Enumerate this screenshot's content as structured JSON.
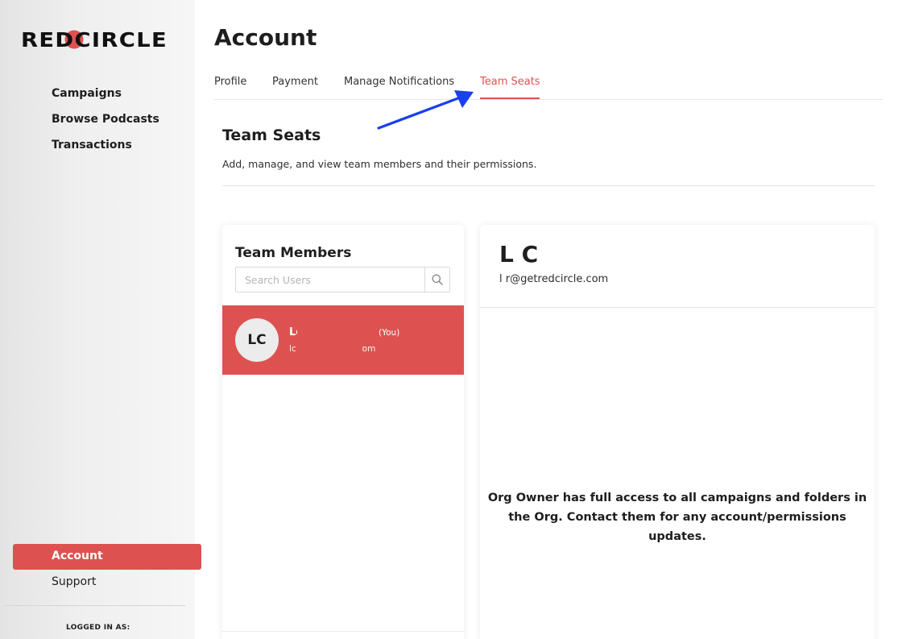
{
  "brand": {
    "logo_text": "REDCIRCLE",
    "accent_color": "#dd5250"
  },
  "sidebar": {
    "nav": [
      {
        "label": "Campaigns"
      },
      {
        "label": "Browse Podcasts"
      },
      {
        "label": "Transactions"
      }
    ],
    "account_label": "Account",
    "support_label": "Support",
    "logged_in_label": "LOGGED IN AS:"
  },
  "header": {
    "title": "Account"
  },
  "tabs": [
    {
      "label": "Profile"
    },
    {
      "label": "Payment"
    },
    {
      "label": "Manage Notifications"
    },
    {
      "label": "Team Seats",
      "active": true
    }
  ],
  "annotation": {
    "arrow_color": "#1a3ff0",
    "arrow_icon": "arrow-icon"
  },
  "section": {
    "title": "Team Seats",
    "description": "Add, manage, and view team members and their permissions."
  },
  "team_members": {
    "title": "Team Members",
    "search_placeholder": "Search Users",
    "search_icon": "search-icon",
    "members": [
      {
        "initials": "LC",
        "name": "Lo   C",
        "you_tag": "(You)",
        "email": "lc@getredcircle.com",
        "selected": true
      }
    ]
  },
  "member_detail": {
    "name": "L      C",
    "email": "l           r@getredcircle.com",
    "notice": "Org Owner has full access to all campaigns and folders in the Org. Contact them for any account/permissions updates."
  }
}
